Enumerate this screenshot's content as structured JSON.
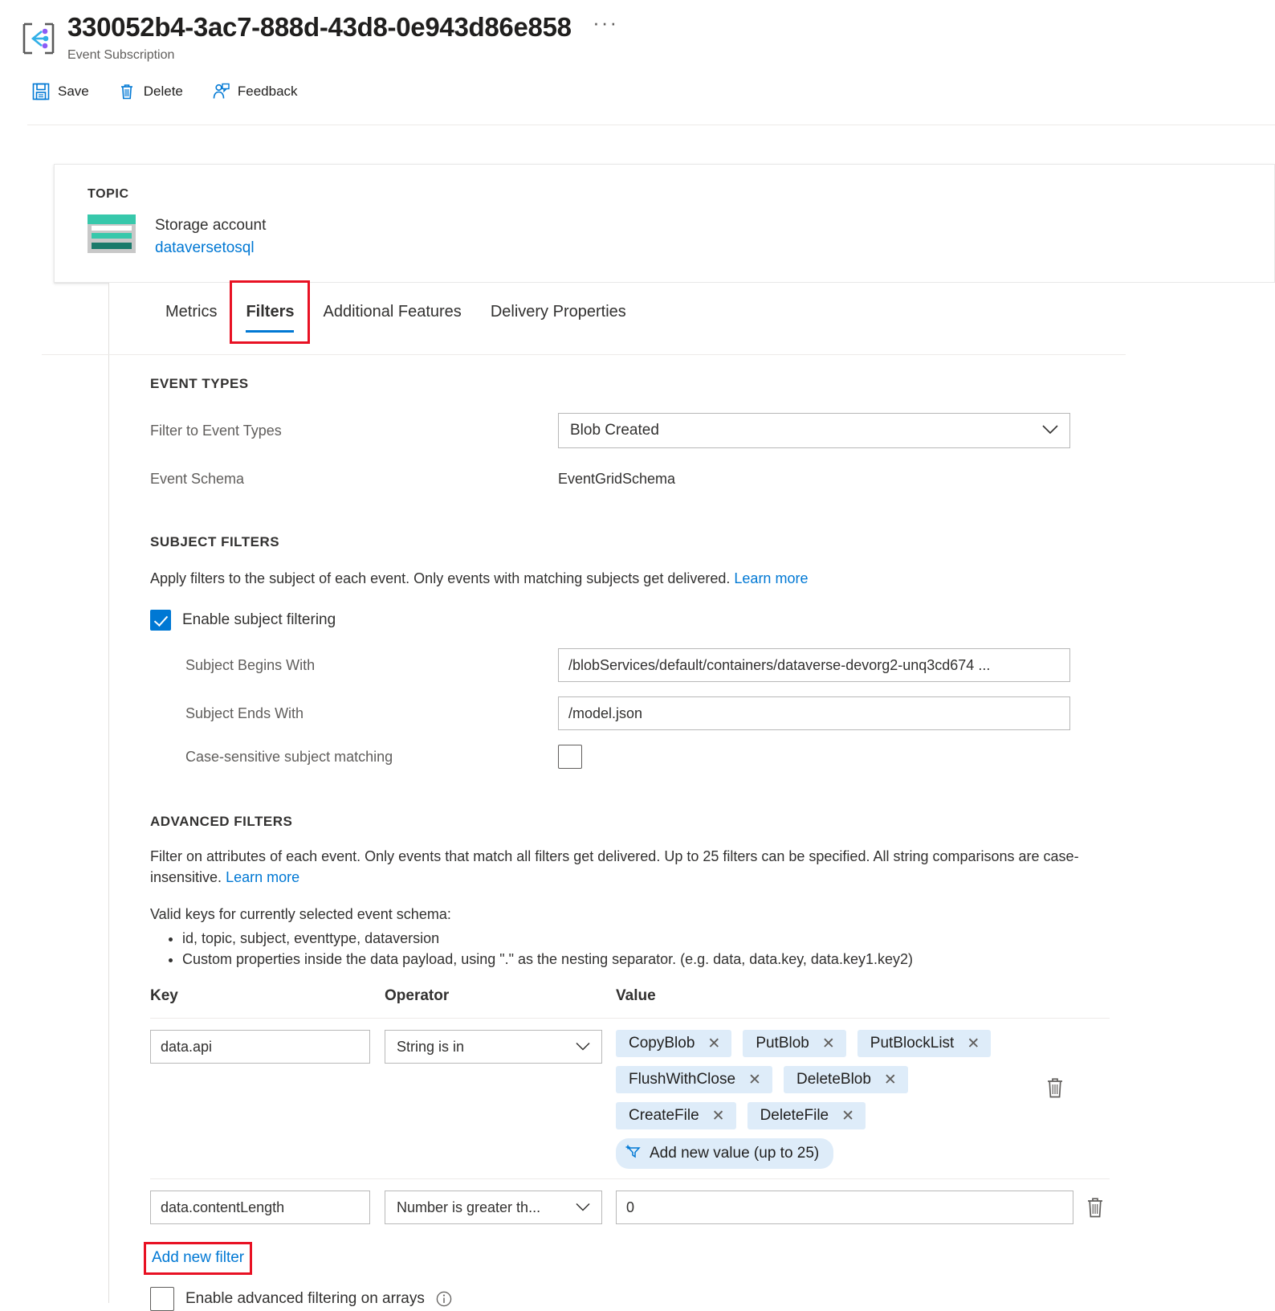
{
  "header": {
    "title": "330052b4-3ac7-888d-43d8-0e943d86e858",
    "subtitle": "Event Subscription",
    "more_label": "···",
    "commands": [
      {
        "label": "Save",
        "icon": "save-icon"
      },
      {
        "label": "Delete",
        "icon": "trash-icon"
      },
      {
        "label": "Feedback",
        "icon": "feedback-icon"
      }
    ]
  },
  "topic": {
    "label": "TOPIC",
    "resource_type": "Storage account",
    "resource_name": "dataversetosql",
    "icon": "storage-account-icon"
  },
  "tabs": [
    {
      "label": "Metrics",
      "selected": false
    },
    {
      "label": "Filters",
      "selected": true
    },
    {
      "label": "Additional Features",
      "selected": false
    },
    {
      "label": "Delivery Properties",
      "selected": false
    }
  ],
  "event_types": {
    "heading": "EVENT TYPES",
    "filter_label": "Filter to Event Types",
    "filter_value": "Blob Created",
    "schema_label": "Event Schema",
    "schema_value": "EventGridSchema"
  },
  "subject_filters": {
    "heading": "SUBJECT FILTERS",
    "description": "Apply filters to the subject of each event. Only events with matching subjects get delivered.",
    "learn_more": "Learn more",
    "enable_label": "Enable subject filtering",
    "enable_checked": true,
    "begins_label": "Subject Begins With",
    "begins_value": "/blobServices/default/containers/dataverse-devorg2-unq3cd674 ...",
    "ends_label": "Subject Ends With",
    "ends_value": "/model.json",
    "case_sensitive_label": "Case-sensitive subject matching",
    "case_sensitive_checked": false
  },
  "advanced_filters": {
    "heading": "ADVANCED FILTERS",
    "description": "Filter on attributes of each event. Only events that match all filters get delivered. Up to 25 filters can be specified. All string comparisons are case-insensitive.",
    "learn_more": "Learn more",
    "valid_keys_intro": "Valid keys for currently selected event schema:",
    "valid_keys": [
      "id, topic, subject, eventtype, dataversion",
      "Custom properties inside the data payload, using \".\" as the nesting separator. (e.g. data, data.key, data.key1.key2)"
    ],
    "columns": {
      "key": "Key",
      "operator": "Operator",
      "value": "Value"
    },
    "rows": [
      {
        "key": "data.api",
        "operator": "String is in",
        "value_type": "chips",
        "chips": [
          "CopyBlob",
          "PutBlob",
          "PutBlockList",
          "FlushWithClose",
          "DeleteBlob",
          "CreateFile",
          "DeleteFile"
        ],
        "add_value_label": "Add new value (up to 25)"
      },
      {
        "key": "data.contentLength",
        "operator": "Number is greater th...",
        "value_type": "text",
        "value": "0"
      }
    ],
    "add_filter_label": "Add new filter",
    "arrays_label": "Enable advanced filtering on arrays",
    "arrays_checked": false
  },
  "colors": {
    "accent": "#0078d4",
    "highlight": "#e81123",
    "chip_bg": "#deecf9",
    "storage_teal": "#37c8ab"
  }
}
